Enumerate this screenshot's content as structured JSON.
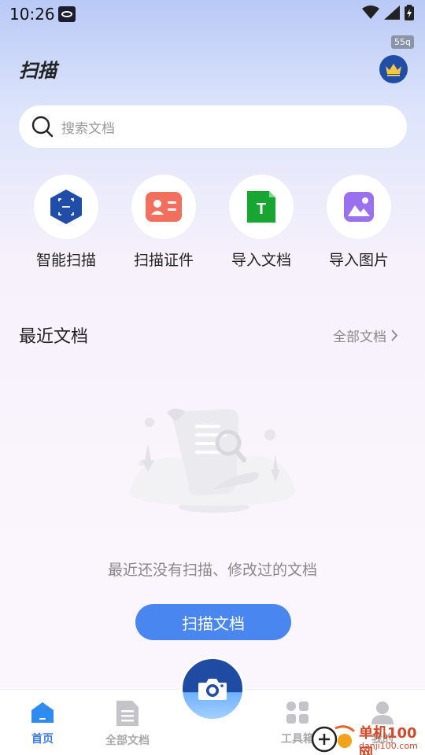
{
  "status_bar": {
    "time": "10:26",
    "speed_badge": "55q"
  },
  "header": {
    "title": "扫描"
  },
  "search": {
    "placeholder": "搜索文档"
  },
  "quick_actions": [
    {
      "label": "智能扫描",
      "icon": "hexagon-scan-icon"
    },
    {
      "label": "扫描证件",
      "icon": "id-card-icon"
    },
    {
      "label": "导入文档",
      "icon": "text-document-icon"
    },
    {
      "label": "导入图片",
      "icon": "image-icon"
    }
  ],
  "recent": {
    "title": "最近文档",
    "all_docs_link": "全部文档"
  },
  "empty_state": {
    "message": "最近还没有扫描、修改过的文档",
    "button_label": "扫描文档"
  },
  "bottom_nav": [
    {
      "label": "首页",
      "active": true
    },
    {
      "label": "全部文档",
      "active": false
    },
    {
      "label": "工具箱",
      "active": false
    },
    {
      "label": "我的",
      "active": false
    }
  ],
  "watermark": {
    "line1": "单机100网",
    "line2": "danji100.com"
  },
  "colors": {
    "primary": "#4a86ef",
    "nav_active": "#3d7be8",
    "fab_dark": "#1f4ba3",
    "vip_bg": "#1f4da8"
  }
}
